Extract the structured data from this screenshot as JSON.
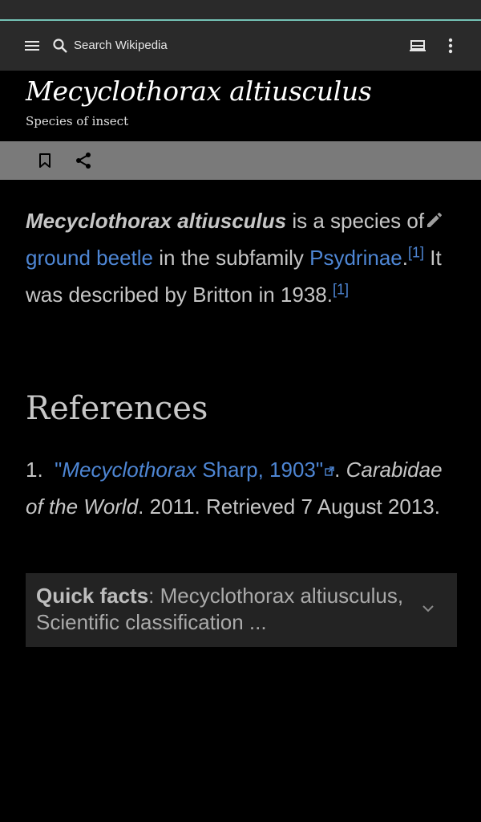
{
  "toolbar": {
    "search_placeholder": "Search Wikipedia"
  },
  "article": {
    "title": "Mecyclothorax altiusculus",
    "subtitle": "Species of insect",
    "intro": {
      "bold_name": "Mecyclothorax altiusculus",
      "t1": " is a species of ",
      "link1": "ground beetle",
      "t2": " in the subfamily ",
      "link2": "Psydrinae",
      "t3": ".",
      "cite1": "[1]",
      "t4": " It was described by Britton in 1938.",
      "cite2": "[1]"
    }
  },
  "references": {
    "heading": "References",
    "items": [
      {
        "number": "1.",
        "open_quote": "\"",
        "link_italic": "Mecyclothorax",
        "link_rest": " Sharp, 1903",
        "close_quote": "\"",
        "after_link": ".",
        "source": "Carabidae of the World",
        "rest": ". 2011. Retrieved 7 August 2013."
      }
    ]
  },
  "quick_facts": {
    "label": "Quick facts",
    "text": ": Mecyclothorax altiusculus, Scientific classification ..."
  },
  "colors": {
    "status_accent": "#74c2b5",
    "link": "#4e86d4",
    "toolbar_bg": "#2a2a2a",
    "action_bar_bg": "#7a7a7a"
  },
  "icons": [
    "menu-icon",
    "search-icon",
    "tabs-icon",
    "more-vert-icon",
    "bookmark-icon",
    "share-icon",
    "edit-icon",
    "external-link-icon",
    "chevron-down-icon"
  ]
}
